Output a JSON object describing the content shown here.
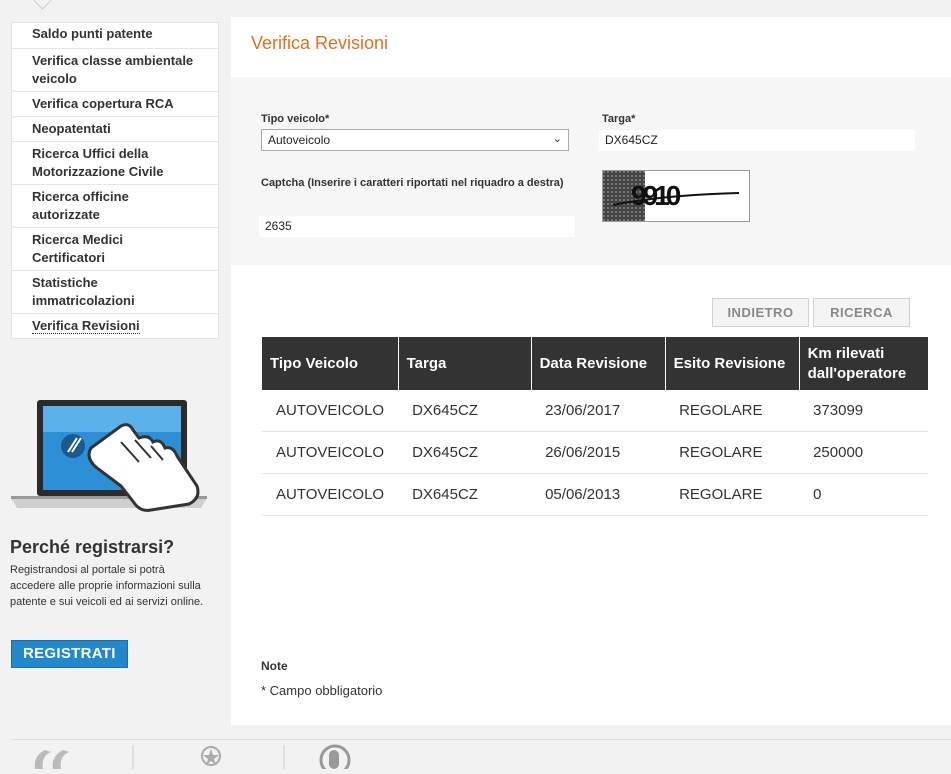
{
  "sidebar": {
    "items": [
      {
        "label": "Saldo punti patente"
      },
      {
        "label": "Verifica classe ambientale veicolo"
      },
      {
        "label": "Verifica copertura RCA"
      },
      {
        "label": "Neopatentati"
      },
      {
        "label": "Ricerca Uffici della Motorizzazione Civile"
      },
      {
        "label": "Ricerca officine autorizzate"
      },
      {
        "label": "Ricerca Medici Certificatori"
      },
      {
        "label": "Statistiche immatricolazioni"
      },
      {
        "label": "Verifica Revisioni"
      }
    ],
    "promo": {
      "title": "Perché registrarsi?",
      "text": "Registrandosi al portale si potrà accedere alle proprie informazioni sulla patente e sui  veicoli ed ai servizi online.",
      "button": "REGISTRATI"
    }
  },
  "main": {
    "title": "Verifica Revisioni",
    "form": {
      "tipo_label": "Tipo veicolo*",
      "tipo_value": "Autoveicolo",
      "targa_label": "Targa*",
      "targa_value": "DX645CZ",
      "captcha_label": "Captcha (Inserire i caratteri riportati nel riquadro a destra)",
      "captcha_value": "2635",
      "captcha_image_text": "9910"
    },
    "buttons": {
      "back": "INDIETRO",
      "search": "RICERCA"
    },
    "table": {
      "headers": [
        "Tipo Veicolo",
        "Targa",
        "Data Revisione",
        "Esito Revisione",
        "Km rilevati dall'operatore"
      ],
      "rows": [
        [
          "AUTOVEICOLO",
          "DX645CZ",
          "23/06/2017",
          "REGOLARE",
          "373099"
        ],
        [
          "AUTOVEICOLO",
          "DX645CZ",
          "26/06/2015",
          "REGOLARE",
          "250000"
        ],
        [
          "AUTOVEICOLO",
          "DX645CZ",
          "05/06/2013",
          "REGOLARE",
          "0"
        ]
      ]
    },
    "note_title": "Note",
    "note_text": "* Campo obbligatorio"
  },
  "colors": {
    "accent": "#e0701f",
    "table_header": "#333333",
    "button_primary": "#2288cc"
  }
}
